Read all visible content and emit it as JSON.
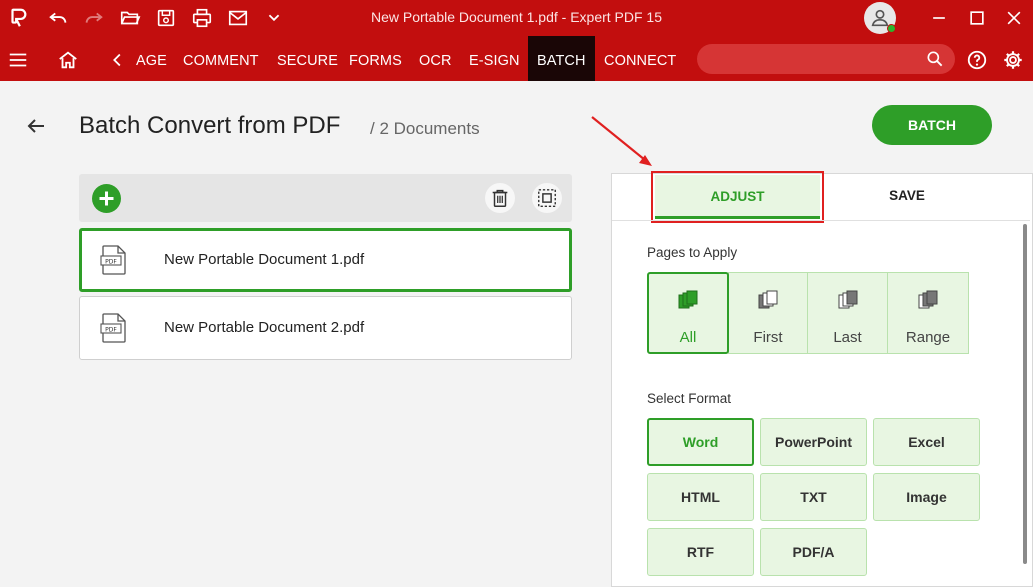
{
  "titlebar": {
    "app_title": "New Portable Document 1.pdf   -   Expert PDF 15"
  },
  "menubar": {
    "items": [
      "AGE",
      "COMMENT",
      "SECURE",
      "FORMS",
      "OCR",
      "E-SIGN",
      "BATCH",
      "CONNECT"
    ],
    "active": "BATCH",
    "search_placeholder": ""
  },
  "header": {
    "title": "Batch Convert from PDF",
    "doc_count": "/ 2 Documents",
    "batch_button": "BATCH"
  },
  "files": [
    {
      "name": "New Portable Document 1.pdf",
      "icon": "PDF",
      "selected": true
    },
    {
      "name": "New Portable Document 2.pdf",
      "icon": "PDF",
      "selected": false
    }
  ],
  "panel": {
    "tabs": [
      "ADJUST",
      "SAVE"
    ],
    "active_tab": "ADJUST",
    "pages_label": "Pages to Apply",
    "pages_options": [
      "All",
      "First",
      "Last",
      "Range"
    ],
    "pages_selected": "All",
    "format_label": "Select Format",
    "formats": [
      "Word",
      "PowerPoint",
      "Excel",
      "HTML",
      "TXT",
      "Image",
      "RTF",
      "PDF/A"
    ],
    "format_selected": "Word"
  },
  "colors": {
    "brand_red": "#c20e0e",
    "accent_green": "#2e9e28",
    "option_bg": "#e8f6e2",
    "highlight_red": "#e02020"
  }
}
